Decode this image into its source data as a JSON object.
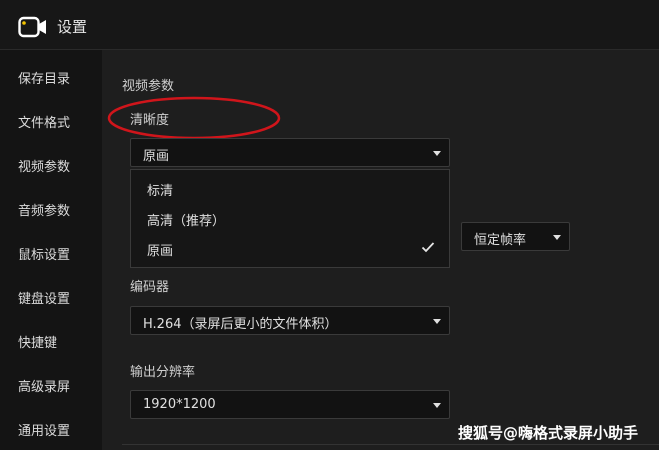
{
  "window": {
    "title": "设置",
    "icon": "camera-icon"
  },
  "sidebar": {
    "items": [
      {
        "label": "保存目录"
      },
      {
        "label": "文件格式"
      },
      {
        "label": "视频参数"
      },
      {
        "label": "音频参数"
      },
      {
        "label": "鼠标设置"
      },
      {
        "label": "键盘设置"
      },
      {
        "label": "快捷键"
      },
      {
        "label": "高级录屏"
      },
      {
        "label": "通用设置"
      }
    ]
  },
  "main": {
    "section_title": "视频参数",
    "clarity": {
      "label": "清晰度",
      "selected": "原画",
      "options": [
        {
          "label": "标清",
          "checked": false
        },
        {
          "label": "高清（推荐）",
          "checked": false
        },
        {
          "label": "原画",
          "checked": true
        }
      ]
    },
    "framerate_mode": {
      "selected": "恒定帧率"
    },
    "encoder": {
      "label": "编码器",
      "selected": "H.264（录屏后更小的文件体积）"
    },
    "resolution": {
      "label": "输出分辨率",
      "selected": "1920*1200"
    }
  },
  "annotation": {
    "color": "#d0151b"
  },
  "watermark": {
    "text": "搜狐号@嗨格式录屏小助手"
  }
}
